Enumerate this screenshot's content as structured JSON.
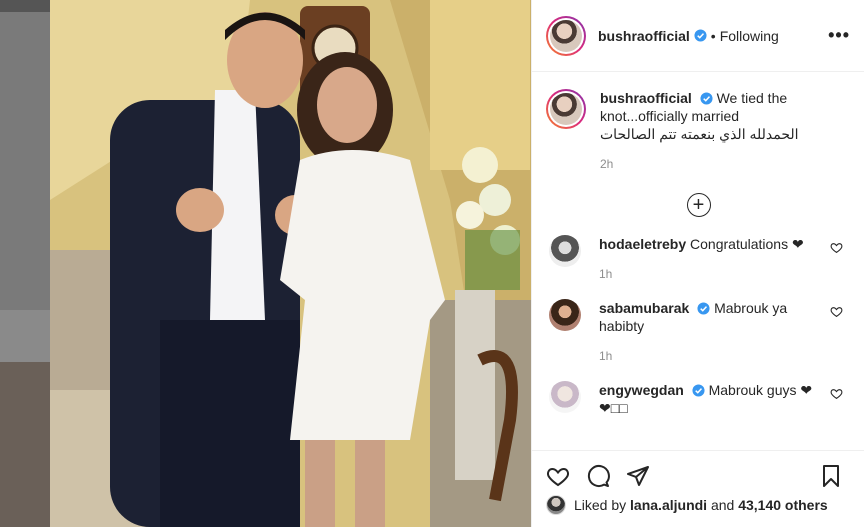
{
  "post": {
    "username": "bushraofficial",
    "separator": "•",
    "following": "Following",
    "more": "•••"
  },
  "caption": {
    "username": "bushraofficial",
    "text": "We tied the knot...officially married",
    "arabic": "الحمدلله الذي بنعمته تتم الصالحات",
    "time": "2h"
  },
  "load_more": "+",
  "comments": [
    {
      "username": "hodaeletreby",
      "text": "Congratulations ❤",
      "verified": false,
      "time": "1h"
    },
    {
      "username": "sabamubarak",
      "text": "Mabrouk ya habibty",
      "verified": true,
      "time": "1h"
    },
    {
      "username": "engywegdan",
      "text": "Mabrouk guys ❤ ❤□□",
      "verified": true,
      "time": ""
    }
  ],
  "likes": {
    "prefix": "Liked by",
    "user": "lana.aljundi",
    "and": "and",
    "count": "43,140 others"
  },
  "colors": {
    "verified": "#3897f0",
    "text": "#262626",
    "muted": "#8e8e8e",
    "border": "#efefef"
  }
}
